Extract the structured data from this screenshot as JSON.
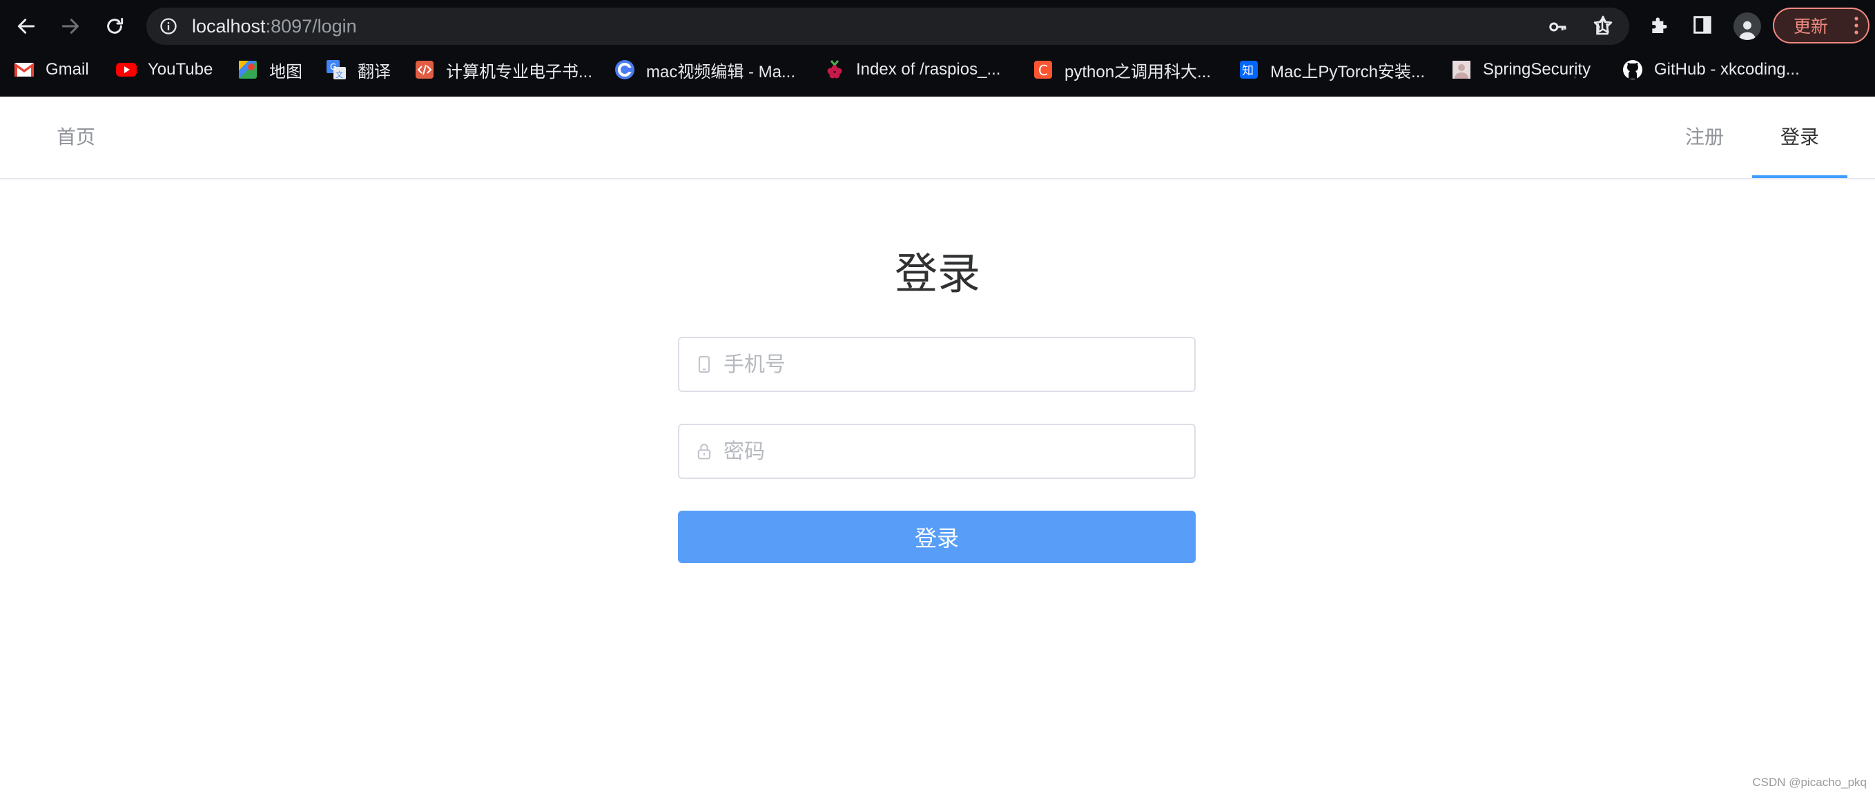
{
  "browser": {
    "url_host": "localhost",
    "url_path": ":8097/login",
    "update_label": "更新",
    "icons": [
      "back-icon",
      "forward-icon",
      "reload-icon",
      "site-info-icon",
      "key-icon",
      "share-icon",
      "star-icon",
      "extensions-icon",
      "side-panel-icon",
      "profile-icon",
      "menu-dots-icon"
    ],
    "bookmarks": [
      {
        "label": "Gmail",
        "icon": "gmail-icon"
      },
      {
        "label": "YouTube",
        "icon": "youtube-icon"
      },
      {
        "label": "地图",
        "icon": "maps-icon"
      },
      {
        "label": "翻译",
        "icon": "translate-icon"
      },
      {
        "label": "计算机专业电子书...",
        "icon": "code-icon"
      },
      {
        "label": "mac视频编辑 - Ma...",
        "icon": "c-logo-icon"
      },
      {
        "label": "Index of /raspios_...",
        "icon": "raspberry-icon"
      },
      {
        "label": "python之调用科大...",
        "icon": "csdn-icon"
      },
      {
        "label": "Mac上PyTorch安装...",
        "icon": "zhihu-icon"
      },
      {
        "label": "SpringSecurity",
        "icon": "avatar-icon"
      },
      {
        "label": "GitHub - xkcoding...",
        "icon": "github-icon"
      }
    ]
  },
  "nav": {
    "home": "首页",
    "register": "注册",
    "login": "登录",
    "accent_color": "#409eff"
  },
  "form": {
    "title": "登录",
    "phone_placeholder": "手机号",
    "password_placeholder": "密码",
    "submit_label": "登录",
    "button_color": "#589ef8"
  },
  "watermark": "CSDN @picacho_pkq"
}
